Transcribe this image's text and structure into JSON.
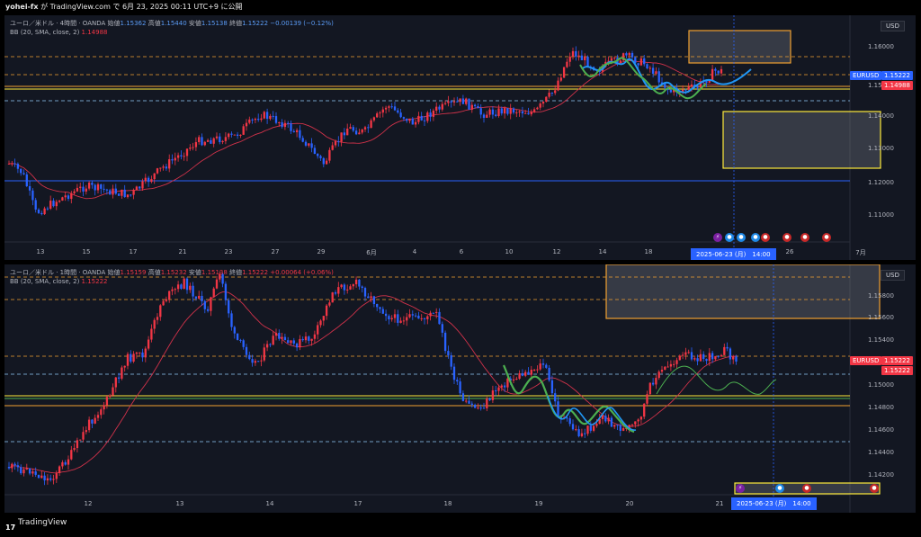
{
  "publish_line": {
    "author": "yohei-fx",
    "text": "が TradingView.com で 6月 23, 2025 00:11 UTC+9 に公開"
  },
  "footer": {
    "brand": "TradingView"
  },
  "colors": {
    "bull": "#f23645",
    "bear": "#2962ff",
    "bb": "#d1324a",
    "zone_orange": "#f0a030",
    "zone_yellow": "#ffeb3b",
    "projection_blue": "#2196f3",
    "projection_green": "#4caf50"
  },
  "top_panel": {
    "legend_line1": {
      "symbol": "ユーロ／米ドル · 4時間 · OANDA",
      "open_label": "始値",
      "open": "1.15362",
      "high_label": "高値",
      "high": "1.15440",
      "low_label": "安値",
      "low": "1.15138",
      "close_label": "終値",
      "close": "1.15222",
      "change": "−0.00139 (−0.12%)"
    },
    "legend_line2": {
      "indicator": "BB (20, SMA, close, 2)",
      "value": "1.14988"
    },
    "currency": "USD",
    "price_ticks": [
      "1.16000",
      "1.15000",
      "1.14000",
      "1.13000",
      "1.12000",
      "1.11000"
    ],
    "price_tags": {
      "symbol": "EURUSD",
      "last": "1.15222",
      "bb": "1.14988"
    },
    "date_ticks": [
      "13",
      "15",
      "17",
      "21",
      "23",
      "27",
      "29",
      "6月",
      "4",
      "6",
      "10",
      "12",
      "14",
      "18",
      "26",
      "7月"
    ],
    "cursor_date": "2025-06-23 (月)　14:00"
  },
  "bottom_panel": {
    "legend_line1": {
      "symbol": "ユーロ／米ドル · 1時間 · OANDA",
      "open_label": "始値",
      "open": "1.15159",
      "high_label": "高値",
      "high": "1.15232",
      "low_label": "安値",
      "low": "1.15138",
      "close_label": "終値",
      "close": "1.15222",
      "change": "+0.00064 (+0.06%)"
    },
    "legend_line2": {
      "indicator": "BB (20, SMA, close, 2)",
      "value": "1.15222"
    },
    "currency": "USD",
    "price_ticks": [
      "1.15800",
      "1.15600",
      "1.15400",
      "1.15000",
      "1.14800",
      "1.14600",
      "1.14400",
      "1.14200"
    ],
    "price_tags": {
      "symbol": "EURUSD",
      "last": "1.15222",
      "bb": "1.15222"
    },
    "date_ticks": [
      "12",
      "13",
      "14",
      "17",
      "18",
      "19",
      "20",
      "21"
    ],
    "cursor_date": "2025-06-23 (月)　14:00"
  }
}
